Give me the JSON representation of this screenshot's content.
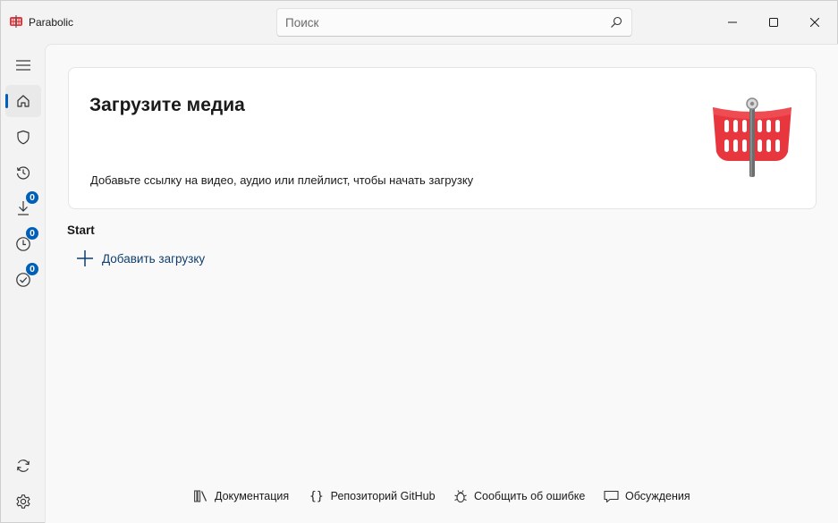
{
  "window": {
    "title": "Parabolic"
  },
  "search": {
    "placeholder": "Поиск"
  },
  "sidebar": {
    "items": [
      {
        "name": "menu"
      },
      {
        "name": "home",
        "active": true
      },
      {
        "name": "shield"
      },
      {
        "name": "history"
      },
      {
        "name": "downloading",
        "badge": "0"
      },
      {
        "name": "queued",
        "badge": "0"
      },
      {
        "name": "completed",
        "badge": "0"
      },
      {
        "name": "sync"
      },
      {
        "name": "settings"
      }
    ]
  },
  "hero": {
    "title": "Загрузите медиа",
    "description": "Добавьте ссылку на видео, аудио или плейлист, чтобы начать загрузку"
  },
  "start": {
    "section_title": "Start",
    "add_download_label": "Добавить загрузку"
  },
  "footer": {
    "docs": "Документация",
    "github": "Репозиторий GitHub",
    "report_bug": "Сообщить об ошибке",
    "discussions": "Обсуждения"
  },
  "colors": {
    "accent": "#005fb8",
    "logo_red": "#e8363e",
    "link": "#0f3f6e"
  }
}
